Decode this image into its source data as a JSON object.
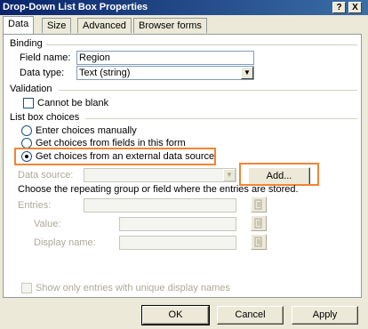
{
  "window": {
    "title": "Drop-Down List Box Properties",
    "help_button": "?",
    "close_button": "X"
  },
  "tabs": [
    {
      "label": "Data",
      "active": true
    },
    {
      "label": "Size",
      "active": false
    },
    {
      "label": "Advanced",
      "active": false
    },
    {
      "label": "Browser forms",
      "active": false
    }
  ],
  "binding": {
    "section_title": "Binding",
    "field_name_label": "Field name:",
    "field_name_value": "Region",
    "data_type_label": "Data type:",
    "data_type_value": "Text (string)"
  },
  "validation": {
    "section_title": "Validation",
    "cannot_be_blank_label": "Cannot be blank",
    "cannot_be_blank_checked": false
  },
  "list_box_choices": {
    "section_title": "List box choices",
    "options": [
      {
        "label": "Enter choices manually",
        "selected": false
      },
      {
        "label": "Get choices from fields in this form",
        "selected": false
      },
      {
        "label": "Get choices from an external data source",
        "selected": true
      }
    ],
    "data_source_label": "Data source:",
    "data_source_value": "",
    "add_button": "Add...",
    "instructions": "Choose the repeating group or field where the entries are stored.",
    "entries_label": "Entries:",
    "value_label": "Value:",
    "display_name_label": "Display name:",
    "unique_names_label": "Show only entries with unique display names"
  },
  "footer": {
    "ok": "OK",
    "cancel": "Cancel",
    "apply": "Apply"
  },
  "colors": {
    "highlight": "#f08536",
    "titlebar": "#0a246a",
    "disabled_text": "#aca899"
  }
}
